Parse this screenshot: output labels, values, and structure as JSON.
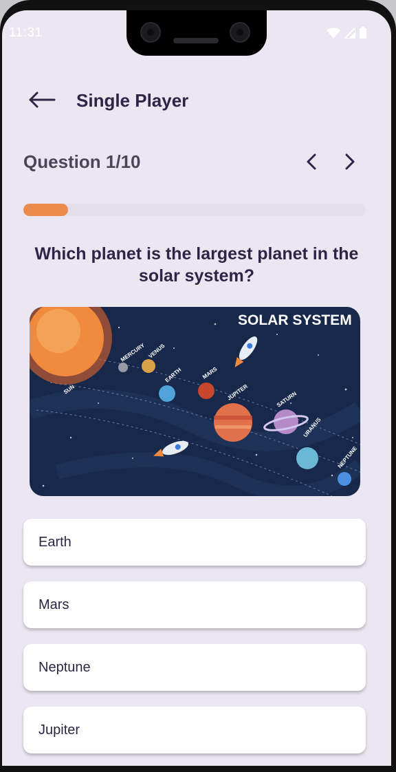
{
  "status_bar": {
    "time": "11:31"
  },
  "header": {
    "title": "Single Player"
  },
  "quiz": {
    "counter": "Question 1/10",
    "progress": 0.13,
    "question": "Which planet is the largest planet in the solar system?"
  },
  "illustration": {
    "title": "SOLAR SYSTEM",
    "labels": {
      "sun": "SUN",
      "mercury": "MERCURY",
      "venus": "VENUS",
      "earth": "EARTH",
      "mars": "MARS",
      "jupiter": "JUPITER",
      "saturn": "SATURN",
      "uranus": "URANUS",
      "neptune": "NEPTUNE"
    }
  },
  "options": [
    {
      "label": "Earth"
    },
    {
      "label": "Mars"
    },
    {
      "label": "Neptune"
    },
    {
      "label": "Jupiter"
    }
  ],
  "colors": {
    "background": "#ebe7f2",
    "accent": "#ec8c4c",
    "text": "#2d2545",
    "illustration_bg": "#17284a"
  },
  "icons": {
    "back": "arrow-left-icon",
    "prev": "chevron-left-icon",
    "next": "chevron-right-icon",
    "wifi": "wifi-icon",
    "signal": "signal-icon",
    "battery": "battery-icon"
  }
}
